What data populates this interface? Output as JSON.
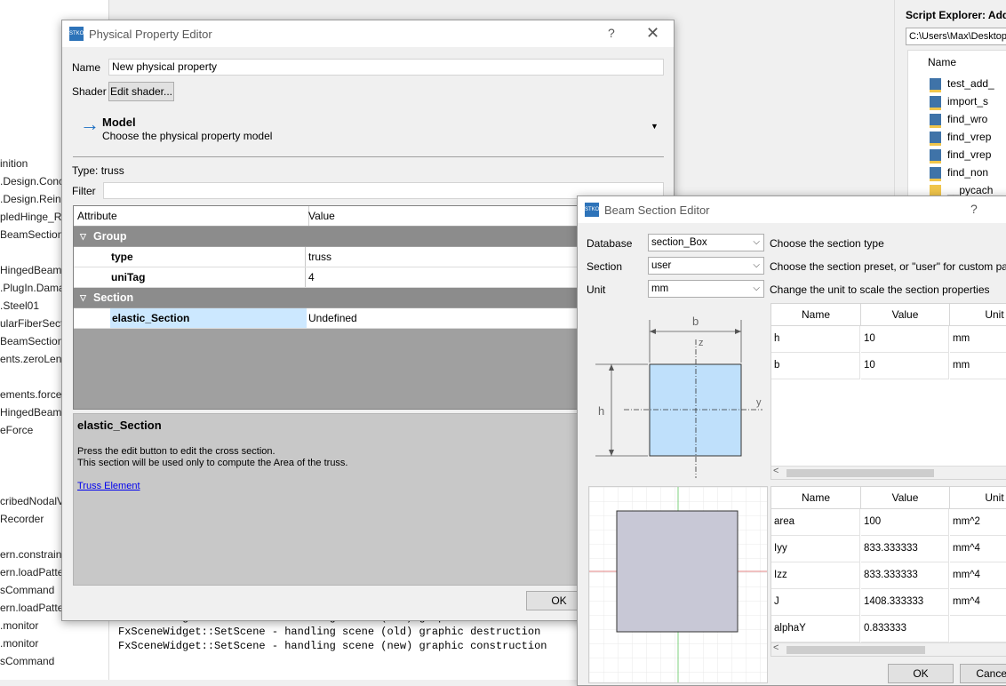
{
  "background": {
    "tree_items": [
      "inition",
      ".Design.Conc",
      ".Design.Reinf",
      "pledHinge_Re",
      "BeamSectionF",
      "HingedBeamF",
      ".PlugIn.Dama",
      ".Steel01",
      "ularFiberSecti",
      "BeamSectionF",
      "ents.zeroLeng",
      "ements.forceB",
      "HingedBeam",
      "eForce",
      "cribedNodalVa",
      "Recorder",
      "ern.constraint",
      "ern.loadPatter",
      "sCommand",
      "ern.loadPattern",
      ".monitor",
      ".monitor",
      "sCommand"
    ],
    "console_lines": [
      "FxSceneWidget::SetScene - handling scene (new) graphic construction",
      "FxSceneWidget::SetScene - handling scene (old) graphic destruction",
      "FxSceneWidget::SetScene - handling scene (new) graphic construction"
    ]
  },
  "script_explorer": {
    "title": "Script Explorer: Add c",
    "path": "C:\\Users\\Max\\Desktop",
    "column": "Name",
    "items": [
      "test_add_",
      "import_s",
      "find_wro",
      "find_vrep",
      "find_vrep",
      "find_non",
      "__pycach"
    ]
  },
  "physical_property_editor": {
    "title": "Physical Property Editor",
    "help_glyph": "?",
    "close_glyph": "✕",
    "logo_text": "STKO",
    "name_label": "Name",
    "name_value": "New physical property",
    "shader_label": "Shader",
    "edit_shader_button": "Edit shader...",
    "model_title": "Model",
    "model_subtitle": "Choose the physical property model",
    "type_label": "Type:",
    "type_value": "truss",
    "filter_label": "Filter",
    "filter_value": "",
    "table_headers": [
      "Attribute",
      "Value"
    ],
    "groups": [
      {
        "name": "Group",
        "rows": [
          {
            "attr": "type",
            "value": "truss"
          },
          {
            "attr": "uniTag",
            "value": "4"
          }
        ]
      },
      {
        "name": "Section",
        "rows": [
          {
            "attr": "elastic_Section",
            "value": "Undefined"
          }
        ]
      }
    ],
    "help_title": "elastic_Section",
    "help_text_1": "Press the edit button to edit the cross section.",
    "help_text_2": "This section will be used only to compute the Area of the truss.",
    "help_link": "Truss Element",
    "ok_button": "OK"
  },
  "beam_section_editor": {
    "title": "Beam Section Editor",
    "help_glyph": "?",
    "logo_text": "STKO",
    "database_label": "Database",
    "database_value": "section_Box",
    "database_desc": "Choose the section type",
    "section_label": "Section",
    "section_value": "user",
    "section_desc": "Choose the section preset, or \"user\" for custom parame",
    "unit_label": "Unit",
    "unit_value": "mm",
    "unit_desc": "Change the unit to scale the section properties",
    "sketch_labels": {
      "b": "b",
      "h": "h",
      "z": "z",
      "y": "y"
    },
    "input_headers": [
      "Name",
      "Value",
      "Unit"
    ],
    "input_rows": [
      {
        "name": "h",
        "value": "10",
        "unit": "mm"
      },
      {
        "name": "b",
        "value": "10",
        "unit": "mm"
      }
    ],
    "output_headers": [
      "Name",
      "Value",
      "Unit"
    ],
    "output_rows": [
      {
        "name": "area",
        "value": "100",
        "unit": "mm^2"
      },
      {
        "name": "Iyy",
        "value": "833.333333",
        "unit": "mm^4"
      },
      {
        "name": "Izz",
        "value": "833.333333",
        "unit": "mm^4"
      },
      {
        "name": "J",
        "value": "1408.333333",
        "unit": "mm^4"
      },
      {
        "name": "alphaY",
        "value": "0.833333",
        "unit": ""
      }
    ],
    "ok_button": "OK",
    "cancel_button": "Cancel"
  },
  "colors": {
    "accent": "#2d73b9",
    "group_row": "#8c8c8c",
    "selection": "#cce8ff",
    "section_fill": "#bfe0fb",
    "preview_fill": "#c8c8d6"
  }
}
